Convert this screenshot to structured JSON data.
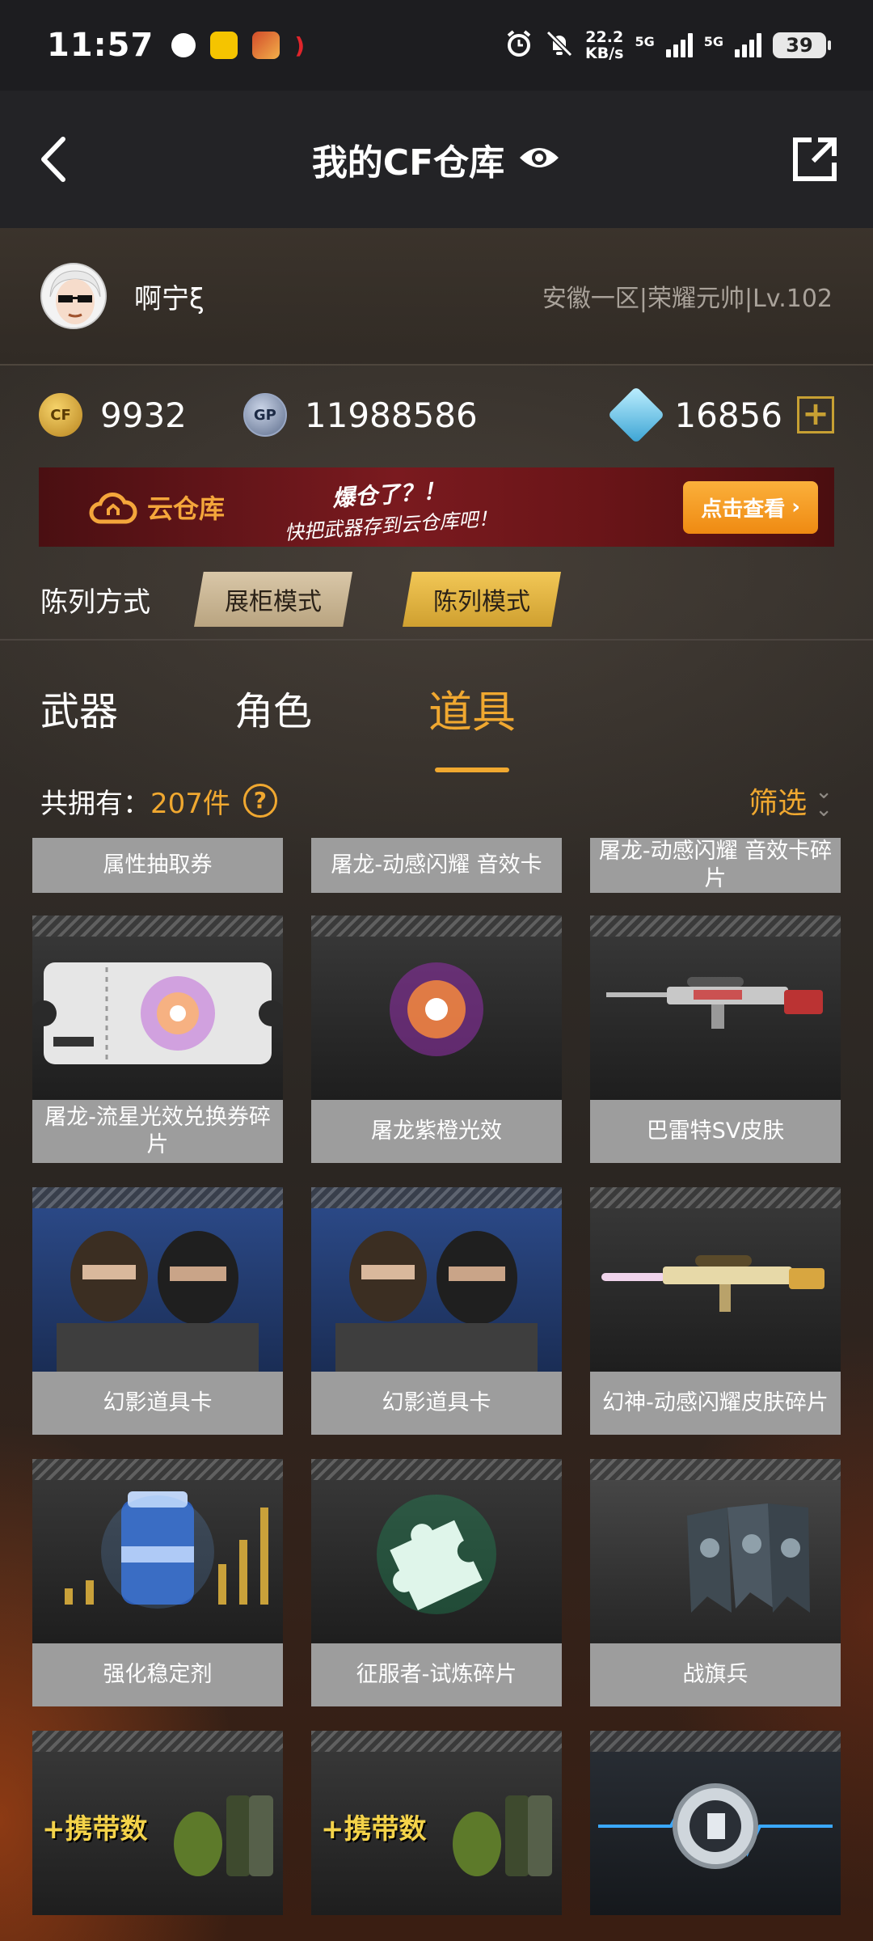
{
  "status_bar": {
    "time": "11:57",
    "net_speed_top": "22.2",
    "net_speed_bottom": "KB/s",
    "sim1": "5G",
    "sim2": "5G",
    "battery": "39"
  },
  "header": {
    "title": "我的CF仓库"
  },
  "profile": {
    "username": "啊宁ξ",
    "server_info": "安徽一区|荣耀元帅|Lv.102"
  },
  "currency": {
    "cf_points": "9932",
    "gp": "11988586",
    "diamonds": "16856",
    "add_label": "+"
  },
  "banner": {
    "title": "云仓库",
    "headline": "爆仓了？！",
    "subline": "快把武器存到云仓库吧！",
    "button": "点击查看"
  },
  "display_mode": {
    "label": "陈列方式",
    "options": [
      "展柜模式",
      "陈列模式"
    ],
    "selected": "陈列模式"
  },
  "tabs": [
    "武器",
    "角色",
    "道具"
  ],
  "active_tab": "道具",
  "inventory": {
    "count_label": "共拥有：",
    "count_value": "207件",
    "help": "?",
    "filter_label": "筛选"
  },
  "items": [
    {
      "name": "属性抽取券",
      "icon": "ticket-icon"
    },
    {
      "name": "屠龙-动感闪耀 音效卡",
      "icon": "sound-card-icon"
    },
    {
      "name": "屠龙-动感闪耀 音效卡碎片",
      "icon": "sound-card-fragment-icon"
    },
    {
      "name": "屠龙-流星光效兑换券碎片",
      "icon": "ticket-icon"
    },
    {
      "name": "屠龙紫橙光效",
      "icon": "glow-orb-icon"
    },
    {
      "name": "巴雷特SV皮肤",
      "icon": "sniper-rifle-icon"
    },
    {
      "name": "幻影道具卡",
      "icon": "soldier-card-icon"
    },
    {
      "name": "幻影道具卡",
      "icon": "soldier-card-icon"
    },
    {
      "name": "幻神-动感闪耀皮肤碎片",
      "icon": "sniper-rifle-icon"
    },
    {
      "name": "强化稳定剂",
      "icon": "stabilizer-icon"
    },
    {
      "name": "征服者-试炼碎片",
      "icon": "puzzle-piece-icon"
    },
    {
      "name": "战旗兵",
      "icon": "war-flag-icon"
    },
    {
      "name": "+携带数",
      "icon": "grenade-carry-icon"
    },
    {
      "name": "+携带数",
      "icon": "grenade-carry-icon"
    },
    {
      "name": "",
      "icon": "pulse-icon"
    }
  ],
  "colors": {
    "accent": "#f0a830",
    "card_label_bg": "#9d9d9d",
    "header_bg": "#232326",
    "banner_red": "#7a1a1f"
  }
}
